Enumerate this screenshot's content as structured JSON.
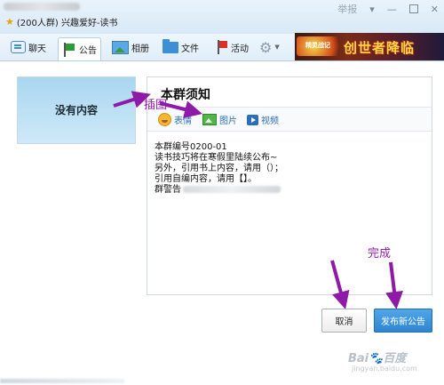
{
  "window": {
    "group_title": "(200人群) 兴趣爱好-读书",
    "report": "举报",
    "controls": [
      "▾",
      "—",
      "✕"
    ]
  },
  "toolbar": {
    "tabs": [
      {
        "label": "聊天",
        "icon": "chat-icon"
      },
      {
        "label": "公告",
        "icon": "flag-icon",
        "active": true
      },
      {
        "label": "相册",
        "icon": "photo-icon"
      },
      {
        "label": "文件",
        "icon": "folder-icon"
      },
      {
        "label": "活动",
        "icon": "red-flag-icon"
      }
    ],
    "settings_icon": "gear-icon",
    "banner": {
      "logo_text": "精灵战记",
      "headline": "创世者降临"
    }
  },
  "image_area": {
    "placeholder": "没有内容"
  },
  "notice": {
    "title": "本群须知",
    "format_buttons": [
      {
        "label": "表情",
        "icon": "emoji-icon"
      },
      {
        "label": "图片",
        "icon": "picture-icon"
      },
      {
        "label": "视频",
        "icon": "video-icon"
      }
    ],
    "lines": [
      "本群编号0200-01",
      "读书技巧将在寒假里陆续公布~",
      "另外，引用书上内容，请用（）；",
      "引用自编内容，请用【】。",
      "群警告"
    ]
  },
  "buttons": {
    "cancel": "取消",
    "publish": "发布新公告"
  },
  "annotations": {
    "insert_image": "插图",
    "done": "完成"
  },
  "watermark": {
    "main": "Bai🐾百度",
    "sub": "jingyan.baidu.com"
  },
  "colors": {
    "annotation": "#9b1fb5",
    "publish_button": "#3a8fd8",
    "accent": "#2d6fb3"
  }
}
